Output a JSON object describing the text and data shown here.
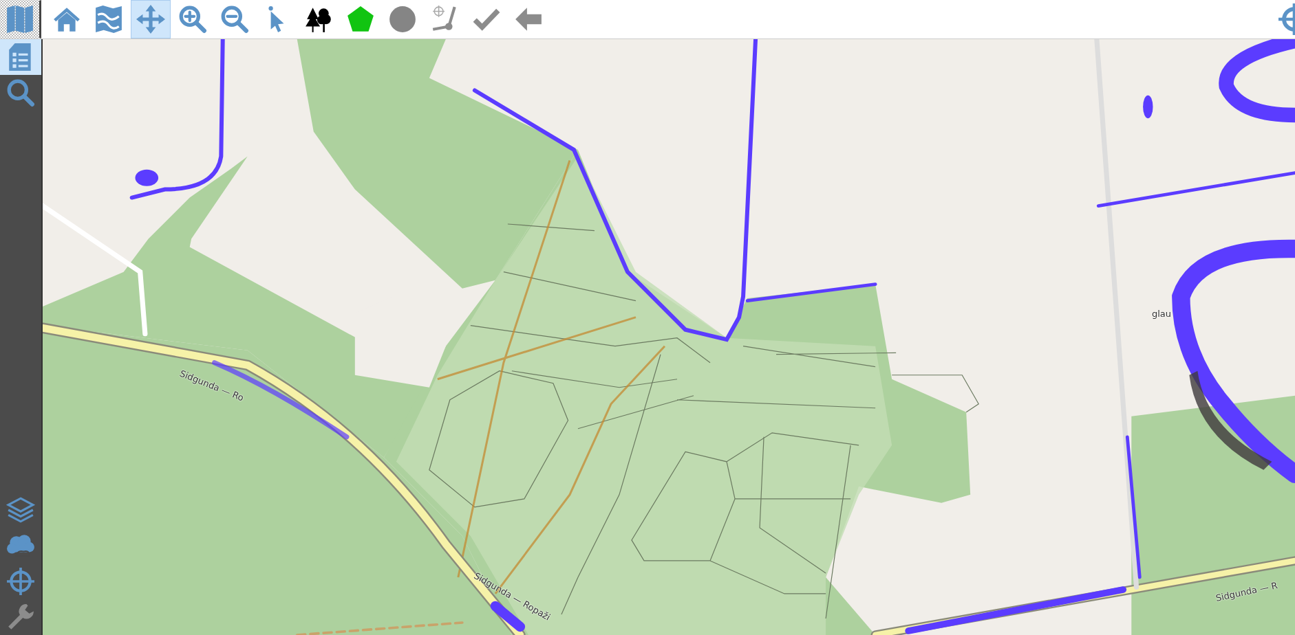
{
  "toolbar": {
    "tools": [
      {
        "kind": "map-panels",
        "selected": false,
        "disabled": false
      },
      {
        "kind": "home",
        "selected": false,
        "disabled": false
      },
      {
        "kind": "folded-map",
        "selected": false,
        "disabled": false
      },
      {
        "kind": "pan",
        "selected": true,
        "disabled": false
      },
      {
        "kind": "zoom-in",
        "selected": false,
        "disabled": false
      },
      {
        "kind": "zoom-out",
        "selected": false,
        "disabled": false
      },
      {
        "kind": "pointer",
        "selected": false,
        "disabled": false
      },
      {
        "kind": "trees",
        "selected": false,
        "disabled": false
      },
      {
        "kind": "pentagon",
        "selected": false,
        "disabled": false
      },
      {
        "kind": "circle",
        "selected": false,
        "disabled": false
      },
      {
        "kind": "measure",
        "selected": false,
        "disabled": true
      },
      {
        "kind": "check",
        "selected": false,
        "disabled": true
      },
      {
        "kind": "back",
        "selected": false,
        "disabled": true
      }
    ],
    "right_tool": {
      "kind": "crosshair",
      "selected": false,
      "disabled": false
    }
  },
  "sidebar": {
    "items": [
      {
        "kind": "document",
        "selected": true,
        "disabled": false
      },
      {
        "kind": "search",
        "selected": false,
        "disabled": false
      }
    ],
    "bottom_items": [
      {
        "kind": "layers",
        "selected": false,
        "disabled": false
      },
      {
        "kind": "cloud",
        "selected": false,
        "disabled": false
      },
      {
        "kind": "crosshair",
        "selected": false,
        "disabled": false
      },
      {
        "kind": "wrench",
        "selected": false,
        "disabled": true
      }
    ]
  },
  "map": {
    "labels": [
      {
        "text": "Sidgunda — Ro"
      },
      {
        "text": "Sidgunda — Ropaži"
      },
      {
        "text": "Sidgunda — R"
      },
      {
        "text": "glau"
      }
    ]
  }
}
